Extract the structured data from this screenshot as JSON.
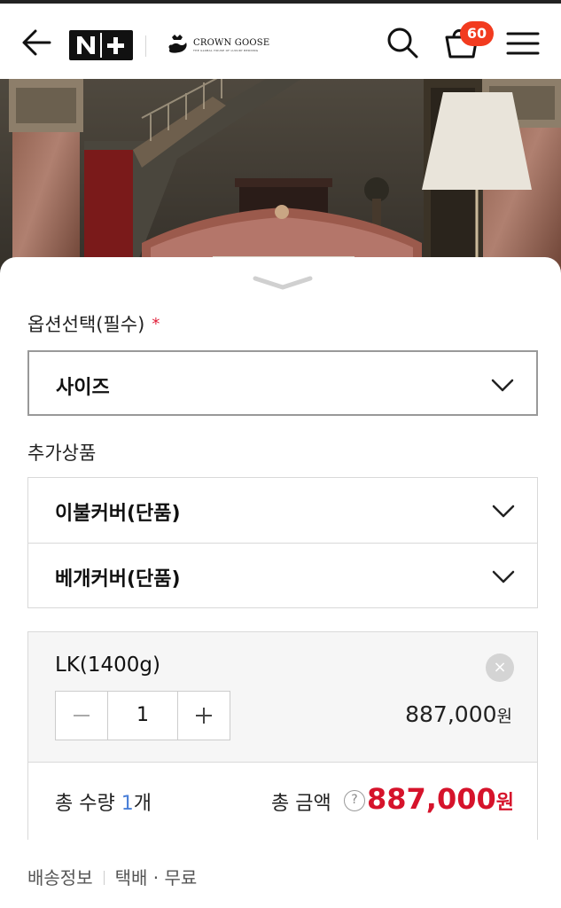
{
  "header": {
    "back_icon": "arrow-left-icon",
    "logo_text": "N+",
    "brand_name": "CROWN GOOSE",
    "brand_tagline": "THE GLOBAL HOUSE OF LUXURY BEDDING",
    "cart_count": "60",
    "badge_color": "#f23b1f"
  },
  "options": {
    "section_label": "옵션선택(필수)",
    "required_mark": "*",
    "size_select": "사이즈"
  },
  "addons": {
    "section_label": "추가상품",
    "items": [
      {
        "label": "이불커버(단품)"
      },
      {
        "label": "베개커버(단품)"
      }
    ]
  },
  "selected_item": {
    "name": "LK(1400g)",
    "remove_label": "×",
    "quantity": "1",
    "price": "887,000",
    "currency": "원"
  },
  "summary": {
    "qty_prefix": "총 수량 ",
    "qty_value": "1",
    "qty_suffix": "개",
    "total_label": "총 금액",
    "help_icon": "?",
    "total_price": "887,000",
    "currency": "원",
    "accent_color": "#d6132b"
  },
  "shipping": {
    "label": "배송정보",
    "method": "택배",
    "dot": "·",
    "fee": "무료"
  }
}
